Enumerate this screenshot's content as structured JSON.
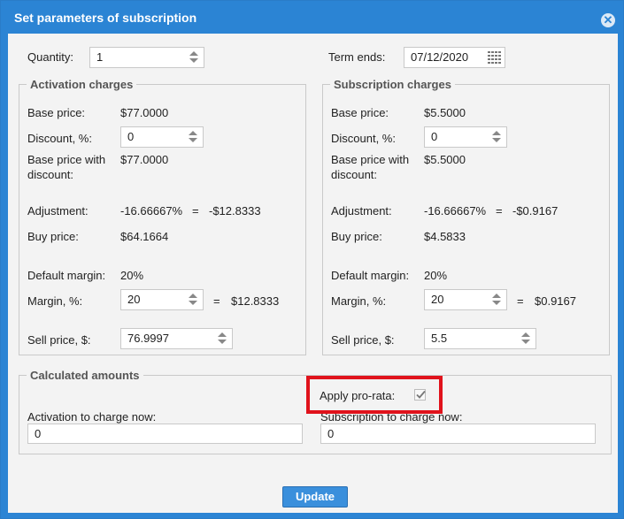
{
  "dialog": {
    "title": "Set parameters of subscription"
  },
  "top": {
    "quantity_label": "Quantity:",
    "quantity_value": "1",
    "term_label": "Term ends:",
    "term_value": "07/12/2020"
  },
  "activation": {
    "legend": "Activation charges",
    "base_price_label": "Base price:",
    "base_price_value": "$77.0000",
    "discount_label": "Discount, %:",
    "discount_value": "0",
    "base_with_discount_label_1": "Base price with",
    "base_with_discount_label_2": "discount:",
    "base_with_discount_value": "$77.0000",
    "adjustment_label": "Adjustment:",
    "adjustment_pct": "-16.66667%",
    "adjustment_eq": "=",
    "adjustment_value": "-$12.8333",
    "buy_price_label": "Buy price:",
    "buy_price_value": "$64.1664",
    "default_margin_label": "Default margin:",
    "default_margin_value": "20%",
    "margin_label": "Margin, %:",
    "margin_value": "20",
    "margin_eq": "=",
    "margin_amount": "$12.8333",
    "sell_price_label": "Sell price, $:",
    "sell_price_value": "76.9997"
  },
  "subscription": {
    "legend": "Subscription charges",
    "base_price_label": "Base price:",
    "base_price_value": "$5.5000",
    "discount_label": "Discount, %:",
    "discount_value": "0",
    "base_with_discount_label_1": "Base price with",
    "base_with_discount_label_2": "discount:",
    "base_with_discount_value": "$5.5000",
    "adjustment_label": "Adjustment:",
    "adjustment_pct": "-16.66667%",
    "adjustment_eq": "=",
    "adjustment_value": "-$0.9167",
    "buy_price_label": "Buy price:",
    "buy_price_value": "$4.5833",
    "default_margin_label": "Default margin:",
    "default_margin_value": "20%",
    "margin_label": "Margin, %:",
    "margin_value": "20",
    "margin_eq": "=",
    "margin_amount": "$0.9167",
    "sell_price_label": "Sell price, $:",
    "sell_price_value": "5.5"
  },
  "calculated": {
    "legend": "Calculated amounts",
    "apply_prorata_label": "Apply pro-rata:",
    "apply_prorata_checked": true,
    "activation_now_label": "Activation to charge now:",
    "activation_now_value": "0",
    "subscription_now_label": "Subscription to charge now:",
    "subscription_now_value": "0"
  },
  "actions": {
    "update_label": "Update"
  },
  "colors": {
    "titlebar": "#2b84d4",
    "highlight": "#e0121b",
    "button": "#3a8fdc"
  }
}
